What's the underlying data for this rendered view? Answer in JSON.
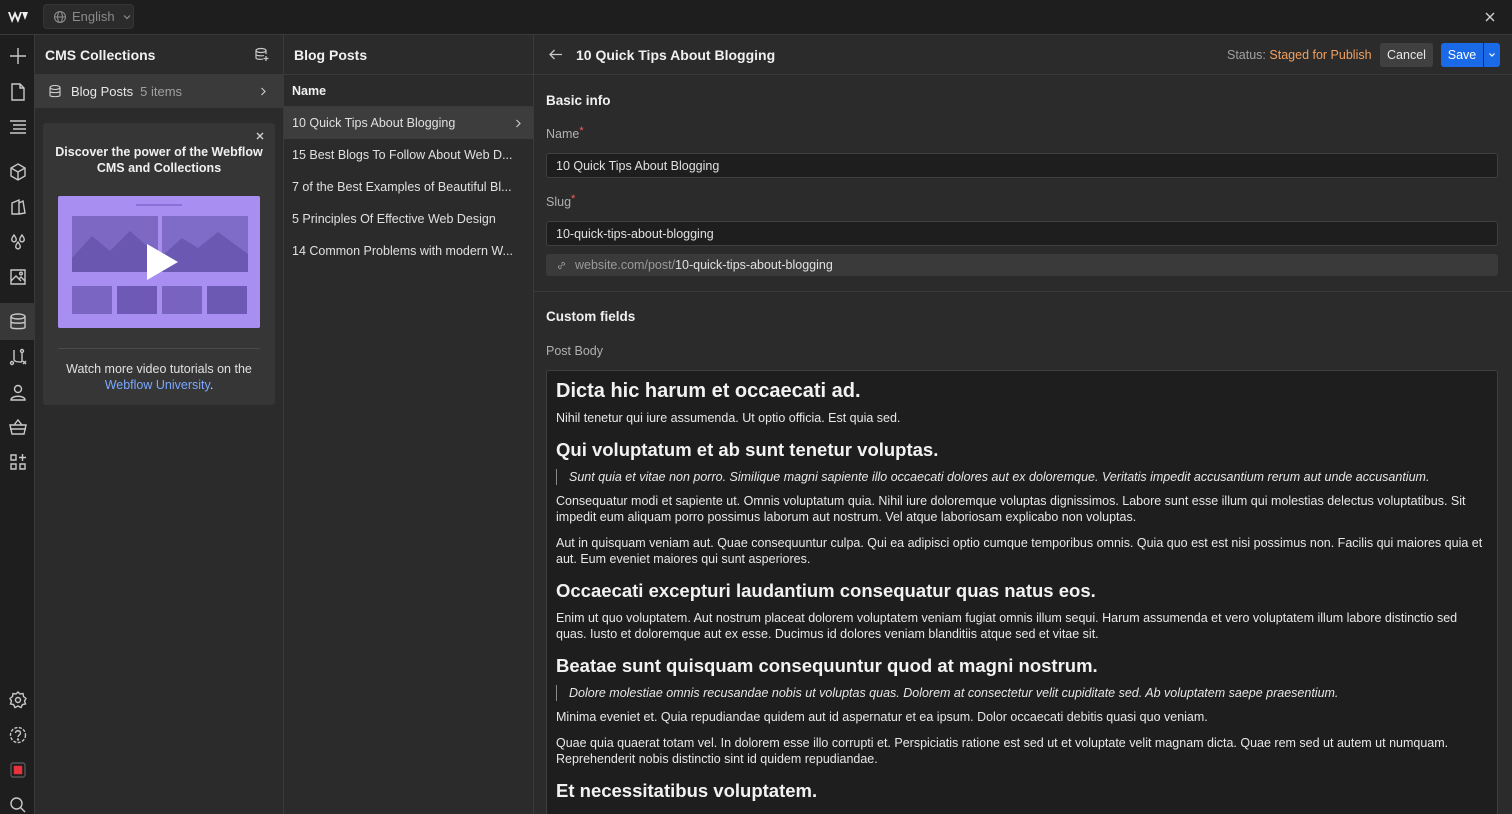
{
  "topbar": {
    "language": "English",
    "logo": "webflow-logo",
    "close_icon": "close-icon"
  },
  "rail": {
    "icons": [
      "add-icon",
      "page-icon",
      "navigator-icon",
      "components-icon",
      "style-manager-icon",
      "variables-icon",
      "assets-icon",
      "cms-icon",
      "logic-icon",
      "users-icon",
      "ecommerce-icon",
      "apps-icon",
      "settings-icon",
      "help-icon",
      "record-icon",
      "search-icon"
    ],
    "active": "cms-icon"
  },
  "collections": {
    "title": "CMS Collections",
    "items": [
      {
        "name": "Blog Posts",
        "count": "5 items"
      }
    ],
    "promo": {
      "title": "Discover the power of the Webflow CMS and Collections",
      "text_before": "Watch more video tutorials on the",
      "link": "Webflow University",
      "text_after": "."
    }
  },
  "items_panel": {
    "title": "Blog Posts",
    "column": "Name",
    "rows": [
      "10 Quick Tips About Blogging",
      "15 Best Blogs To Follow About Web D...",
      "7 of the Best Examples of Beautiful Bl...",
      "5 Principles Of Effective Web Design",
      "14 Common Problems with modern W..."
    ],
    "selected_index": 0
  },
  "editor": {
    "title": "10 Quick Tips About Blogging",
    "status_label": "Status:",
    "status_value": "Staged for Publish",
    "cancel_label": "Cancel",
    "save_label": "Save",
    "basic_info_title": "Basic info",
    "name_label": "Name",
    "name_value": "10 Quick Tips About Blogging",
    "required_mark": "*",
    "slug_label": "Slug",
    "slug_value": "10-quick-tips-about-blogging",
    "slug_preview_prefix": "website.com/post/",
    "slug_preview_value": "10-quick-tips-about-blogging",
    "custom_fields_title": "Custom fields",
    "post_body_label": "Post Body",
    "body": {
      "h1": "Dicta hic harum et occaecati ad.",
      "p1": "Nihil tenetur qui iure assumenda. Ut optio officia. Est quia sed.",
      "h2": "Qui voluptatum et ab sunt tenetur voluptas.",
      "q1": "Sunt quia et vitae non porro. Similique magni sapiente illo occaecati dolores aut ex doloremque. Veritatis impedit accusantium rerum aut unde accusantium.",
      "p2": "Consequatur modi et sapiente ut. Omnis voluptatum quia. Nihil iure doloremque voluptas dignissimos. Labore sunt esse illum qui molestias delectus voluptatibus. Sit impedit eum aliquam porro possimus laborum aut nostrum. Vel atque laboriosam explicabo non voluptas.",
      "p3": "Aut in quisquam veniam aut. Quae consequuntur culpa. Qui ea adipisci optio cumque temporibus omnis. Quia quo est est nisi possimus non. Facilis qui maiores quia et aut. Eum eveniet maiores qui sunt asperiores.",
      "h3": "Occaecati excepturi laudantium consequatur quas natus eos.",
      "p4": "Enim ut quo voluptatem. Aut nostrum placeat dolorem voluptatem veniam fugiat omnis illum sequi. Harum assumenda et vero voluptatem illum labore distinctio sed quas. Iusto et doloremque aut ex esse. Ducimus id dolores veniam blanditiis atque sed et vitae sit.",
      "h4": "Beatae sunt quisquam consequuntur quod at magni nostrum.",
      "q2": "Dolore molestiae omnis recusandae nobis ut voluptas quas. Dolorem at consectetur velit cupiditate sed. Ab voluptatem saepe praesentium.",
      "p5": "Minima eveniet et. Quia repudiandae quidem aut id aspernatur et ea ipsum. Dolor occaecati debitis quasi quo veniam.",
      "p6": "Quae quia quaerat totam vel. In dolorem esse illo corrupti et. Perspiciatis ratione est sed ut et voluptate velit magnam dicta. Quae rem sed ut autem ut numquam. Reprehenderit nobis distinctio sint id quidem repudiandae.",
      "h5": "Et necessitatibus voluptatem."
    }
  },
  "colors": {
    "accent": "#1a6ae8",
    "status": "#f0a060",
    "link": "#7aa8ff",
    "video_bg": "#a88ef0"
  }
}
